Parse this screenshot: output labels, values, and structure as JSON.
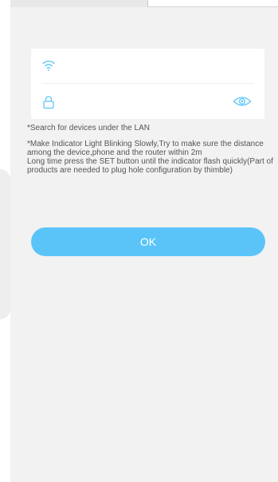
{
  "form": {
    "hint_search": "*Search for devices under the LAN",
    "hint_indicator": "*Make Indicator Light Blinking Slowly,Try to make sure the distance among the device,phone and the router within 2m\nLong time press the SET button until the indicator flash quickly(Part of products are needed to plug hole configuration by thimble)",
    "ok_label": "OK"
  },
  "icons": {
    "wifi": "wifi-icon",
    "lock": "lock-icon",
    "eye": "eye-icon"
  },
  "colors": {
    "accent": "#5ac4f9",
    "background": "#f2f2f2",
    "card": "#ffffff"
  }
}
